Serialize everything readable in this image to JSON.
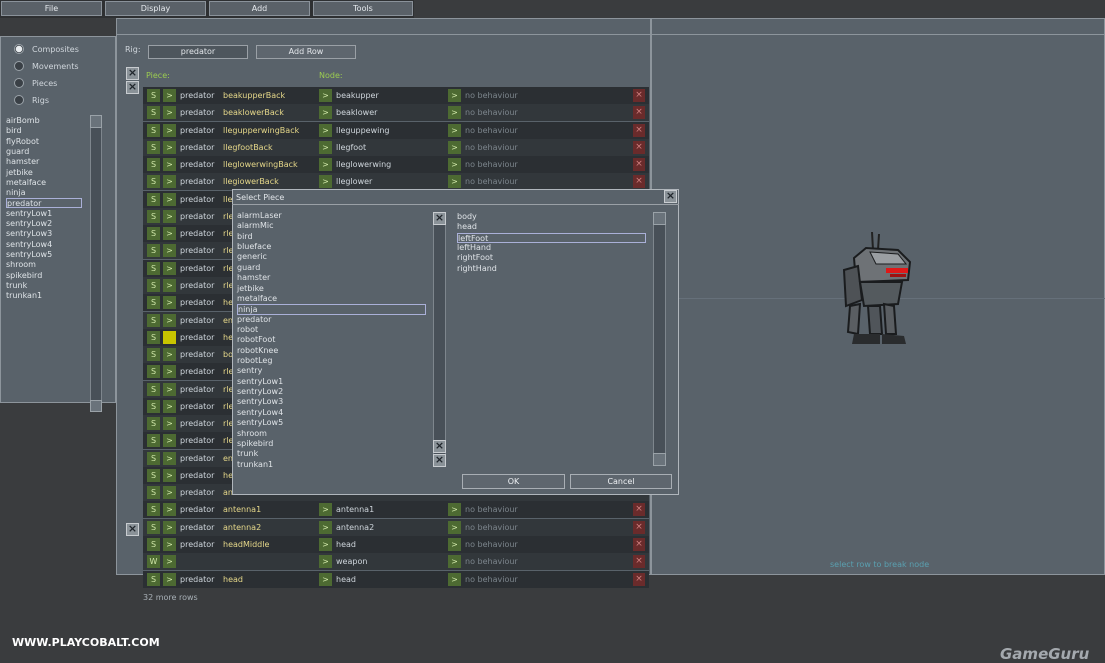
{
  "menu": [
    "File",
    "Display",
    "Add",
    "Tools"
  ],
  "left": {
    "radios": [
      {
        "label": "Composites",
        "selected": true
      },
      {
        "label": "Movements",
        "selected": false
      },
      {
        "label": "Pieces",
        "selected": false
      },
      {
        "label": "Rigs",
        "selected": false
      }
    ],
    "items": [
      "airBomb",
      "bird",
      "flyRobot",
      "guard",
      "hamster",
      "jetbike",
      "metalface",
      "ninja",
      "predator",
      "sentryLow1",
      "sentryLow2",
      "sentryLow3",
      "sentryLow4",
      "sentryLow5",
      "shroom",
      "spikebird",
      "trunk",
      "trunkan1"
    ],
    "selected_index": 8
  },
  "rig": {
    "label": "Rig:",
    "value": "predator",
    "add_row": "Add Row"
  },
  "columns": {
    "piece": "Piece:",
    "node": "Node:"
  },
  "rows": [
    {
      "s": "S",
      "pre": "predator",
      "piece": "beakupperBack",
      "node": "beakupper",
      "beh": "no behaviour"
    },
    {
      "s": "S",
      "pre": "predator",
      "piece": "beaklowerBack",
      "node": "beaklower",
      "beh": "no behaviour"
    },
    {
      "s": "S",
      "pre": "predator",
      "piece": "llegupperwingBack",
      "node": "lleguppewing",
      "beh": "no behaviour"
    },
    {
      "s": "S",
      "pre": "predator",
      "piece": "llegfootBack",
      "node": "llegfoot",
      "beh": "no behaviour"
    },
    {
      "s": "S",
      "pre": "predator",
      "piece": "lleglowerwingBack",
      "node": "lleglowerwing",
      "beh": "no behaviour"
    },
    {
      "s": "S",
      "pre": "predator",
      "piece": "llegiowerBack",
      "node": "lleglower",
      "beh": "no behaviour"
    },
    {
      "s": "S",
      "pre": "predator",
      "piece": "lle",
      "node": "",
      "beh": ""
    },
    {
      "s": "S",
      "pre": "predator",
      "piece": "rle",
      "node": "",
      "beh": ""
    },
    {
      "s": "S",
      "pre": "predator",
      "piece": "rle",
      "node": "",
      "beh": ""
    },
    {
      "s": "S",
      "pre": "predator",
      "piece": "rle",
      "node": "",
      "beh": ""
    },
    {
      "s": "S",
      "pre": "predator",
      "piece": "rle",
      "node": "",
      "beh": ""
    },
    {
      "s": "S",
      "pre": "predator",
      "piece": "rle",
      "node": "",
      "beh": ""
    },
    {
      "s": "S",
      "pre": "predator",
      "piece": "he",
      "node": "",
      "beh": ""
    },
    {
      "s": "S",
      "pre": "predator",
      "piece": "en",
      "node": "",
      "beh": ""
    },
    {
      "s": "S",
      "pre": "predator",
      "piece": "he",
      "node": "",
      "beh": "",
      "yellow": true
    },
    {
      "s": "S",
      "pre": "predator",
      "piece": "bo",
      "node": "",
      "beh": ""
    },
    {
      "s": "S",
      "pre": "predator",
      "piece": "rle",
      "node": "",
      "beh": ""
    },
    {
      "s": "S",
      "pre": "predator",
      "piece": "rle",
      "node": "",
      "beh": ""
    },
    {
      "s": "S",
      "pre": "predator",
      "piece": "rle",
      "node": "",
      "beh": ""
    },
    {
      "s": "S",
      "pre": "predator",
      "piece": "rle",
      "node": "",
      "beh": ""
    },
    {
      "s": "S",
      "pre": "predator",
      "piece": "rle",
      "node": "",
      "beh": ""
    },
    {
      "s": "S",
      "pre": "predator",
      "piece": "en",
      "node": "",
      "beh": ""
    },
    {
      "s": "S",
      "pre": "predator",
      "piece": "he",
      "node": "",
      "beh": ""
    },
    {
      "s": "S",
      "pre": "predator",
      "piece": "an",
      "node": "",
      "beh": ""
    },
    {
      "s": "S",
      "pre": "predator",
      "piece": "antenna1",
      "node": "antenna1",
      "beh": "no behaviour"
    },
    {
      "s": "S",
      "pre": "predator",
      "piece": "antenna2",
      "node": "antenna2",
      "beh": "no behaviour"
    },
    {
      "s": "S",
      "pre": "predator",
      "piece": "headMiddle",
      "node": "head",
      "beh": "no behaviour"
    },
    {
      "s": "W",
      "pre": "",
      "piece": "",
      "node": "weapon",
      "beh": "no behaviour"
    },
    {
      "s": "S",
      "pre": "predator",
      "piece": "head",
      "node": "head",
      "beh": "no behaviour"
    }
  ],
  "arrow": ">",
  "more_rows": "32 more rows",
  "hint": "select row to break node",
  "site": "WWW.PLAYCOBALT.COM",
  "watermark": "GameGuru",
  "dialog": {
    "title": "Select Piece",
    "left_items": [
      "alarmLaser",
      "alarmMic",
      "bird",
      "blueface",
      "generic",
      "guard",
      "hamster",
      "jetbike",
      "metalface",
      "ninja",
      "predator",
      "robot",
      "robotFoot",
      "robotKnee",
      "robotLeg",
      "sentry",
      "sentryLow1",
      "sentryLow2",
      "sentryLow3",
      "sentryLow4",
      "sentryLow5",
      "shroom",
      "spikebird",
      "trunk",
      "trunkan1"
    ],
    "left_selected": 9,
    "right_items": [
      "body",
      "head",
      "leftFoot",
      "leftHand",
      "rightFoot",
      "rightHand"
    ],
    "right_selected": 2,
    "ok": "OK",
    "cancel": "Cancel"
  }
}
